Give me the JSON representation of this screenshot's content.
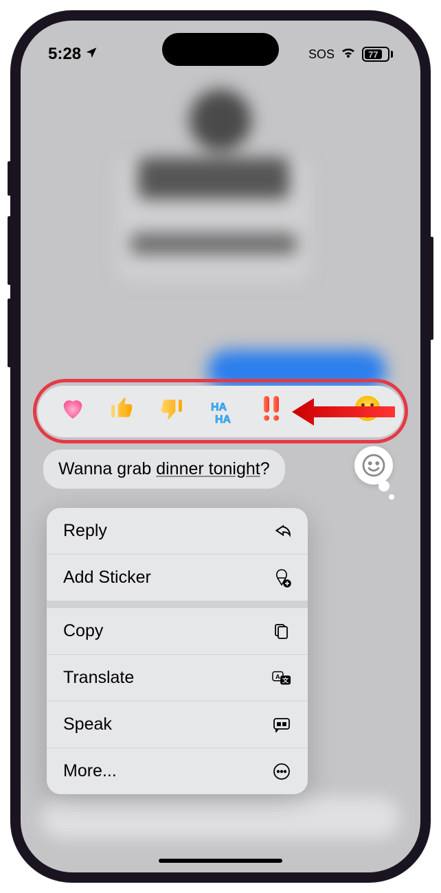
{
  "status": {
    "time": "5:28",
    "sos": "SOS",
    "battery": "77"
  },
  "tapback": {
    "heart": "heart",
    "thumbsup": "thumbs-up",
    "thumbsdown": "thumbs-down",
    "haha": "HA HA",
    "exclaim": "!!",
    "emoji": "smiley"
  },
  "message": {
    "text_prefix": "Wanna grab ",
    "text_underlined": "dinner tonight",
    "text_suffix": "?"
  },
  "menu": {
    "reply": "Reply",
    "add_sticker": "Add Sticker",
    "copy": "Copy",
    "translate": "Translate",
    "speak": "Speak",
    "more": "More..."
  }
}
